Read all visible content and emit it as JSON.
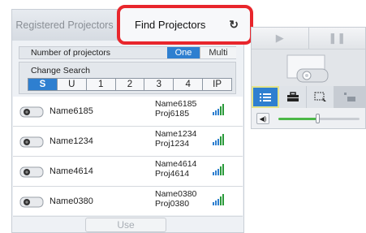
{
  "tabs": {
    "registered": "Registered Projectors",
    "find": "Find Projectors",
    "refresh_icon": "refresh-icon"
  },
  "count": {
    "label": "Number of projectors",
    "options": [
      "One",
      "Multi"
    ],
    "selected": "One"
  },
  "search": {
    "label": "Change Search",
    "keys": [
      "S",
      "U",
      "1",
      "2",
      "3",
      "4",
      "IP"
    ],
    "selected": "S"
  },
  "projectors": [
    {
      "name": "Name6185",
      "right_name": "Name6185",
      "right_proj": "Proj6185"
    },
    {
      "name": "Name1234",
      "right_name": "Name1234",
      "right_proj": "Proj1234"
    },
    {
      "name": "Name4614",
      "right_name": "Name4614",
      "right_proj": "Proj4614"
    },
    {
      "name": "Name0380",
      "right_name": "Name0380",
      "right_proj": "Proj0380"
    }
  ],
  "use_button": "Use",
  "controls": {
    "play_glyph": "▶",
    "pause_glyph": "❚❚",
    "volume_level": 0.48,
    "colors": {
      "accent": "#2e7fd0",
      "highlight": "#e8262c",
      "volume": "#4cb848"
    }
  }
}
